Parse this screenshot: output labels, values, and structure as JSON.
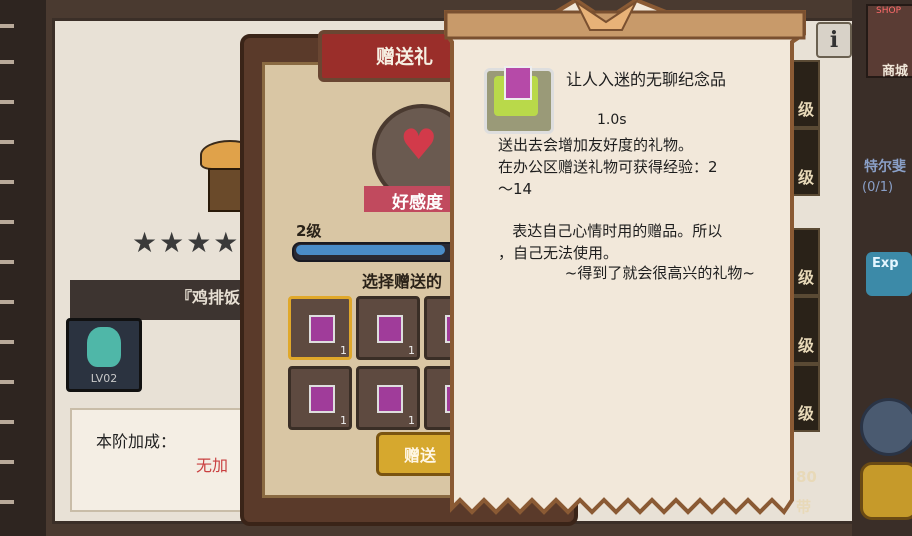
{
  "background": {
    "character_name": "『鸡排饭",
    "avatar_level": "LV02",
    "bonus_label": "本阶加成：",
    "bonus_value": "无加",
    "stars": "★★★★"
  },
  "sidebar_right": {
    "shop_badge": "SHOP",
    "shop_label": "商城",
    "quest_text": "特尔斐",
    "quest_count": "(0/1)",
    "exp_badge": "Exp",
    "level_tags": [
      "级",
      "级",
      "级",
      "级",
      "级"
    ],
    "count_80": "80",
    "count_dai": "带"
  },
  "gift_dialog": {
    "title": "赠送礼",
    "favor_label": "好感度",
    "level_label": "2级",
    "progress": 0.8,
    "choose_label": "选择赠送的",
    "slot_counts": [
      "1",
      "1",
      "",
      "1",
      "1",
      ""
    ],
    "send_label": "赠送"
  },
  "tooltip": {
    "item_name": "让人入迷的无聊纪念品",
    "duration": "1.0s",
    "lines": [
      "送出去会增加友好度的礼物。",
      "在办公区赠送礼物可获得经验：2",
      "～14",
      "",
      "   表达自己心情时用的赠品。所以",
      "，自己无法使用。",
      "              ~得到了就会很高兴的礼物~"
    ]
  },
  "info_button": "i",
  "colors": {
    "accent_red": "#9a2e2a",
    "favor_pink": "#c14a5e",
    "gift_purple": "#b64aa8",
    "send_gold": "#d6a82e"
  }
}
